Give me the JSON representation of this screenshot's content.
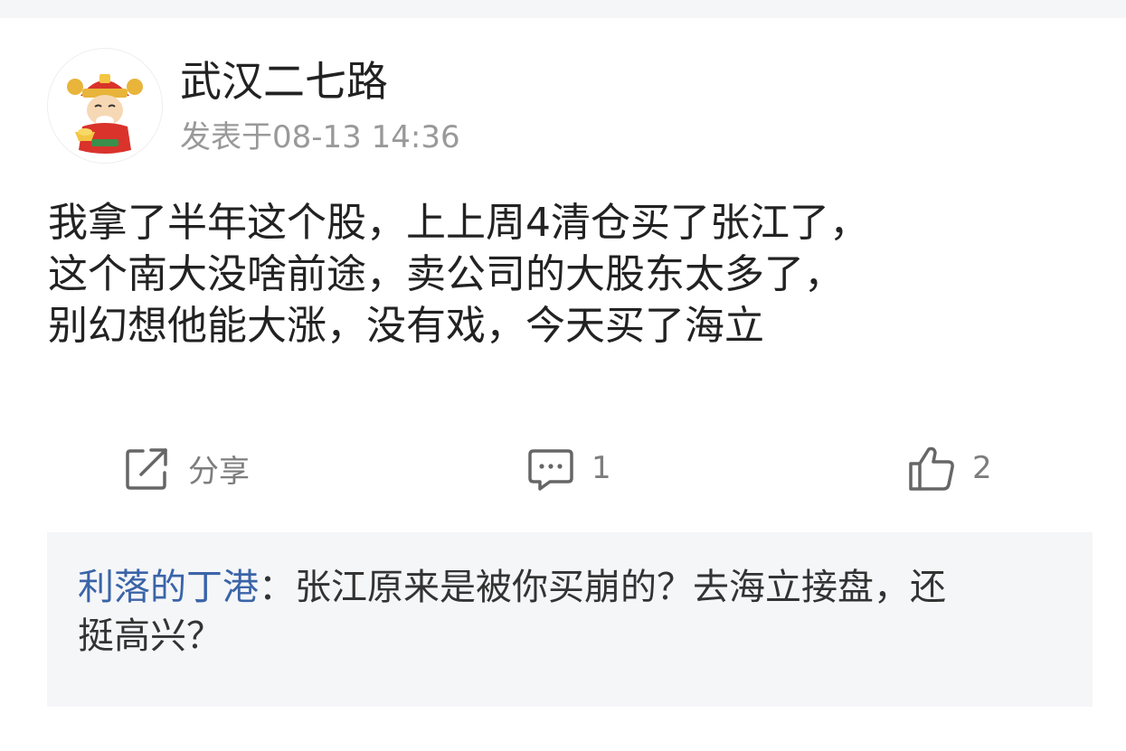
{
  "post": {
    "username": "武汉二七路",
    "timestamp": "发表于08-13 14:36",
    "content_lines": [
      "我拿了半年这个股，上上周4清仓买了张江了，",
      "这个南大没啥前途，卖公司的大股东太多了，",
      "别幻想他能大涨，没有戏，今天买了海立"
    ],
    "avatar_icon": "fortune-god-avatar"
  },
  "actions": {
    "share_label": "分享",
    "comment_count": "1",
    "like_count": "2",
    "share_icon": "share-icon",
    "comment_icon": "comment-icon",
    "like_icon": "thumbs-up-icon"
  },
  "comment": {
    "author": "利落的丁港",
    "separator": "：",
    "text_line1": "张江原来是被你买崩的？去海立接盘，还",
    "text_line2": "挺高兴？"
  },
  "colors": {
    "author_link": "#3a64a8",
    "muted": "#999999",
    "comment_bg": "#f5f6f8"
  }
}
